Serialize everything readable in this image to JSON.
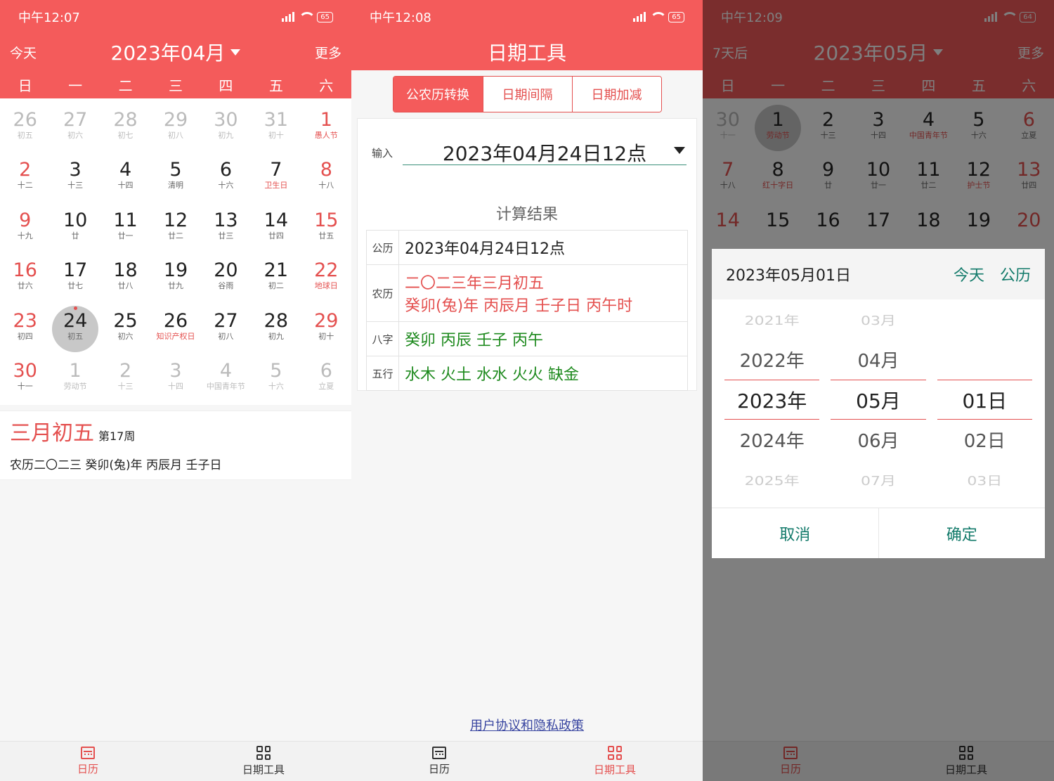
{
  "screen1": {
    "status": {
      "time": "中午12:07",
      "battery": "65"
    },
    "header": {
      "today": "今天",
      "month": "2023年04月",
      "more": "更多"
    },
    "weekdays": [
      "日",
      "一",
      "二",
      "三",
      "四",
      "五",
      "六"
    ],
    "days": [
      {
        "d": "26",
        "s": "初五",
        "dim": true
      },
      {
        "d": "27",
        "s": "初六",
        "dim": true
      },
      {
        "d": "28",
        "s": "初七",
        "dim": true
      },
      {
        "d": "29",
        "s": "初八",
        "dim": true
      },
      {
        "d": "30",
        "s": "初九",
        "dim": true
      },
      {
        "d": "31",
        "s": "初十",
        "dim": true
      },
      {
        "d": "1",
        "s": "愚人节",
        "we": true,
        "fest": true
      },
      {
        "d": "2",
        "s": "十二",
        "we": true
      },
      {
        "d": "3",
        "s": "十三"
      },
      {
        "d": "4",
        "s": "十四"
      },
      {
        "d": "5",
        "s": "清明"
      },
      {
        "d": "6",
        "s": "十六"
      },
      {
        "d": "7",
        "s": "卫生日",
        "fest": true
      },
      {
        "d": "8",
        "s": "十八",
        "we": true
      },
      {
        "d": "9",
        "s": "十九",
        "we": true
      },
      {
        "d": "10",
        "s": "廿"
      },
      {
        "d": "11",
        "s": "廿一"
      },
      {
        "d": "12",
        "s": "廿二"
      },
      {
        "d": "13",
        "s": "廿三"
      },
      {
        "d": "14",
        "s": "廿四"
      },
      {
        "d": "15",
        "s": "廿五",
        "we": true
      },
      {
        "d": "16",
        "s": "廿六",
        "we": true
      },
      {
        "d": "17",
        "s": "廿七"
      },
      {
        "d": "18",
        "s": "廿八"
      },
      {
        "d": "19",
        "s": "廿九"
      },
      {
        "d": "20",
        "s": "谷雨"
      },
      {
        "d": "21",
        "s": "初二"
      },
      {
        "d": "22",
        "s": "地球日",
        "we": true,
        "fest": true
      },
      {
        "d": "23",
        "s": "初四",
        "we": true
      },
      {
        "d": "24",
        "s": "初五",
        "sel": true,
        "dot": true
      },
      {
        "d": "25",
        "s": "初六"
      },
      {
        "d": "26",
        "s": "知识产权日",
        "fest": true
      },
      {
        "d": "27",
        "s": "初八"
      },
      {
        "d": "28",
        "s": "初九"
      },
      {
        "d": "29",
        "s": "初十",
        "we": true
      },
      {
        "d": "30",
        "s": "十一",
        "we": true
      },
      {
        "d": "1",
        "s": "劳动节",
        "dim": true
      },
      {
        "d": "2",
        "s": "十三",
        "dim": true
      },
      {
        "d": "3",
        "s": "十四",
        "dim": true
      },
      {
        "d": "4",
        "s": "中国青年节",
        "dim": true
      },
      {
        "d": "5",
        "s": "十六",
        "dim": true
      },
      {
        "d": "6",
        "s": "立夏",
        "dim": true
      }
    ],
    "info": {
      "lunar": "三月初五",
      "week": "第17周",
      "line": "农历二〇二三 癸卯(兔)年 丙辰月 壬子日"
    },
    "tabs": [
      "日历",
      "日期工具"
    ]
  },
  "screen2": {
    "status": {
      "time": "中午12:08",
      "battery": "65"
    },
    "title": "日期工具",
    "segments": [
      "公农历转换",
      "日期间隔",
      "日期加减"
    ],
    "input_label": "输入",
    "input_value": "2023年04月24日12点",
    "result_title": "计算结果",
    "rows": [
      {
        "k": "公历",
        "v": [
          "2023年04月24日12点"
        ],
        "color": "plain"
      },
      {
        "k": "农历",
        "v": [
          "二〇二三年三月初五",
          "癸卯(兔)年 丙辰月 壬子日 丙午时"
        ],
        "color": "red"
      },
      {
        "k": "八字",
        "v": [
          "癸卯 丙辰 壬子 丙午"
        ],
        "color": "green"
      },
      {
        "k": "五行",
        "v": [
          "水木 火土 水水 火火  缺金"
        ],
        "color": "green"
      }
    ],
    "privacy": "用户协议和隐私政策",
    "tabs": [
      "日历",
      "日期工具"
    ]
  },
  "screen3": {
    "status": {
      "time": "中午12:09",
      "battery": "64"
    },
    "header": {
      "today": "7天后",
      "month": "2023年05月",
      "more": "更多"
    },
    "weekdays": [
      "日",
      "一",
      "二",
      "三",
      "四",
      "五",
      "六"
    ],
    "days": [
      {
        "d": "30",
        "s": "十一",
        "dim": true
      },
      {
        "d": "1",
        "s": "劳动节",
        "fest": true,
        "sel": true
      },
      {
        "d": "2",
        "s": "十三"
      },
      {
        "d": "3",
        "s": "十四"
      },
      {
        "d": "4",
        "s": "中国青年节",
        "fest": true
      },
      {
        "d": "5",
        "s": "十六"
      },
      {
        "d": "6",
        "s": "立夏",
        "we": true
      },
      {
        "d": "7",
        "s": "十八",
        "we": true
      },
      {
        "d": "8",
        "s": "红十字日",
        "fest": true
      },
      {
        "d": "9",
        "s": "廿"
      },
      {
        "d": "10",
        "s": "廿一"
      },
      {
        "d": "11",
        "s": "廿二"
      },
      {
        "d": "12",
        "s": "护士节",
        "fest": true
      },
      {
        "d": "13",
        "s": "廿四",
        "we": true
      },
      {
        "d": "14",
        "s": "",
        "we": true
      },
      {
        "d": "15",
        "s": ""
      },
      {
        "d": "16",
        "s": ""
      },
      {
        "d": "17",
        "s": ""
      },
      {
        "d": "18",
        "s": ""
      },
      {
        "d": "19",
        "s": ""
      },
      {
        "d": "20",
        "s": "",
        "we": true
      }
    ],
    "dialog": {
      "date": "2023年05月01日",
      "today_btn": "今天",
      "calendar_btn": "公历",
      "years": [
        "2021年",
        "2022年",
        "2023年",
        "2024年",
        "2025年"
      ],
      "months": [
        "03月",
        "04月",
        "05月",
        "06月",
        "07月"
      ],
      "days": [
        "",
        "",
        "01日",
        "02日",
        "03日"
      ],
      "cancel": "取消",
      "ok": "确定"
    },
    "tabs": [
      "日历",
      "日期工具"
    ]
  }
}
